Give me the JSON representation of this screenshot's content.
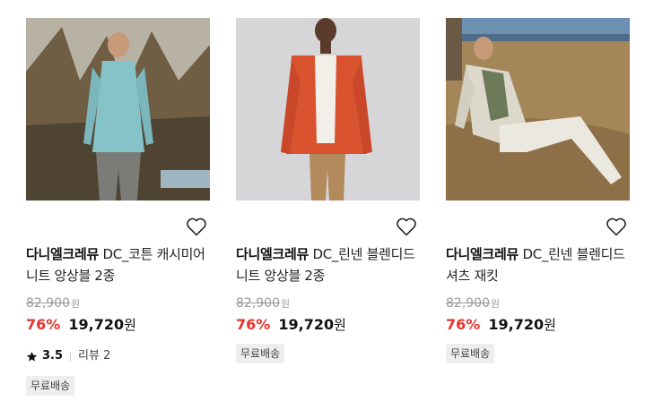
{
  "products": [
    {
      "brand": "다니엘크레뮤",
      "name": "DC_코튼 캐시미어 니트 앙상블 2종",
      "original_price": "82,900",
      "original_unit": "원",
      "discount": "76%",
      "price": "19,720",
      "price_unit": "원",
      "rating": "3.5",
      "reviews": "리뷰 2",
      "badge": "무료배송",
      "image": "man in mint cardigan standing among trees",
      "colors": {
        "garment": "#86c3c9",
        "bg": "#7a6a52"
      }
    },
    {
      "brand": "다니엘크레뮤",
      "name": "DC_린넨 블렌디드 니트 앙상블 2종",
      "original_price": "82,900",
      "original_unit": "원",
      "discount": "76%",
      "price": "19,720",
      "price_unit": "원",
      "badge": "무료배송",
      "image": "man in orange cardigan on gray studio background",
      "colors": {
        "garment": "#d9532e",
        "bg": "#d6d6d8"
      }
    },
    {
      "brand": "다니엘크레뮤",
      "name": "DC_린넨 블렌디드 셔츠 재킷",
      "original_price": "82,900",
      "original_unit": "원",
      "discount": "76%",
      "price": "19,720",
      "price_unit": "원",
      "badge": "무료배송",
      "image": "man in beige shirt jacket sitting in dry grass",
      "colors": {
        "garment": "#ddd8cc",
        "bg": "#a48658"
      }
    }
  ],
  "icons": {
    "wish": "heart-outline-icon",
    "rating": "star-icon"
  },
  "colors": {
    "discount": "#e8322c",
    "strike": "#9a9a9a",
    "badge_bg": "#eeeeee"
  }
}
